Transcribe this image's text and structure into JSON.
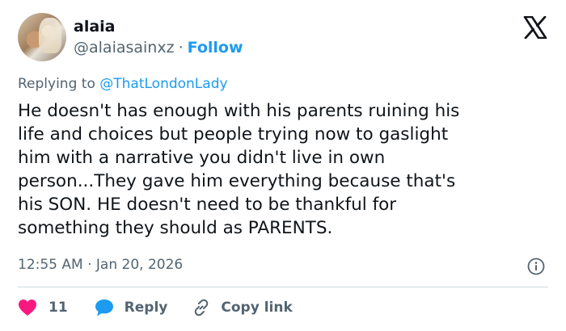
{
  "user": {
    "display_name": "alaia",
    "handle": "@alaiasainxz",
    "separator": "·",
    "follow_label": "Follow"
  },
  "reply_context": {
    "prefix": "Replying to ",
    "mention": "@ThatLondonLady"
  },
  "tweet": {
    "text": "He doesn't has enough with his parents ruining his\nlife and choices but people trying now to gaslight\nhim with a narrative you didn't live in own\nperson...They gave him everything because that's\nhis SON. HE doesn't need to be thankful for\nsomething they should as PARENTS.",
    "timestamp": "12:55 AM · Jan 20, 2026"
  },
  "actions": {
    "likes_count": "11",
    "reply_label": "Reply",
    "copy_link_label": "Copy link"
  },
  "colors": {
    "accent": "#1d9bf0",
    "like": "#f91880",
    "secondary_text": "#536471",
    "divider": "#cfd9de"
  },
  "icons": [
    "x-logo-icon",
    "info-icon",
    "heart-icon",
    "reply-bubble-icon",
    "link-icon"
  ]
}
